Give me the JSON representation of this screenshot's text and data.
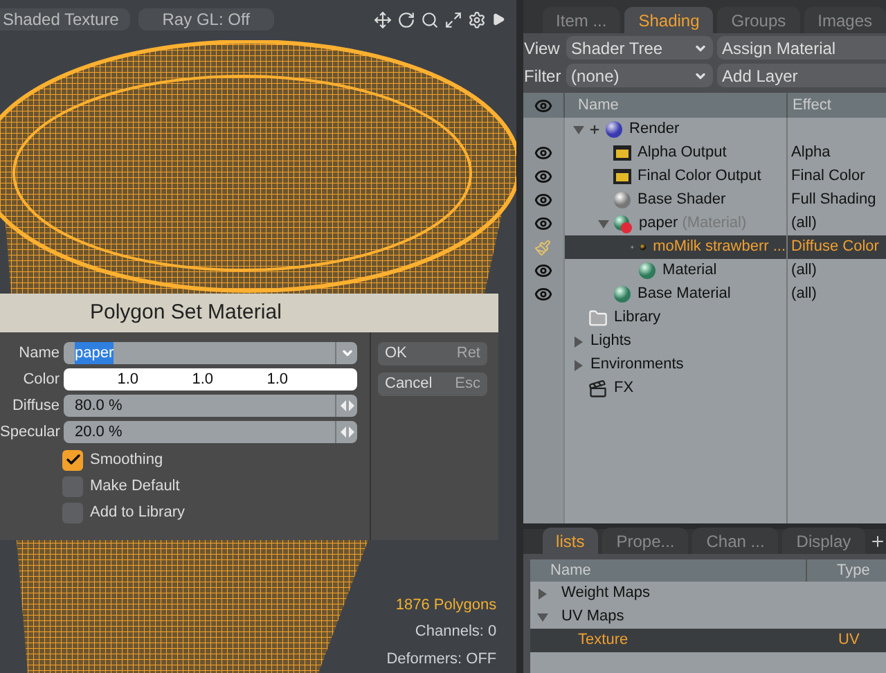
{
  "viewport": {
    "shading_mode": "Shaded Texture",
    "ray_gl": "Ray GL: Off",
    "stats": [
      {
        "text": "1876 Polygons",
        "highlight": true
      },
      {
        "text": "Channels: 0",
        "highlight": false
      },
      {
        "text": "Deformers: OFF",
        "highlight": false
      }
    ]
  },
  "dialog": {
    "title": "Polygon Set Material",
    "fields": [
      {
        "kind": "dropdown",
        "label": "Name",
        "value": "paper",
        "text_selected": true
      },
      {
        "kind": "color",
        "label": "Color",
        "values": [
          "1.0",
          "1.0",
          "1.0"
        ]
      },
      {
        "kind": "spinner",
        "label": "Diffuse",
        "value": "80.0 %"
      },
      {
        "kind": "spinner",
        "label": "Specular",
        "value": "20.0 %"
      }
    ],
    "checkboxes": [
      {
        "label": "Smoothing",
        "checked": true
      },
      {
        "label": "Make Default",
        "checked": false
      },
      {
        "label": "Add to Library",
        "checked": false
      }
    ],
    "buttons": [
      {
        "label": "OK",
        "shortcut": "Ret"
      },
      {
        "label": "Cancel",
        "shortcut": "Esc"
      }
    ]
  },
  "shader_panel": {
    "tabs": [
      {
        "label": "Item ...",
        "selected": false
      },
      {
        "label": "Shading",
        "selected": true
      },
      {
        "label": "Groups",
        "selected": false
      },
      {
        "label": "Images",
        "selected": false
      }
    ],
    "view": {
      "label": "View",
      "value": "Shader Tree",
      "action": "Assign Material"
    },
    "filter": {
      "label": "Filter",
      "value": "(none)",
      "action": "Add Layer"
    },
    "columns": [
      "Name",
      "Effect"
    ],
    "tree": [
      {
        "kind": "render",
        "name": "Render",
        "expanded": true,
        "plus": true,
        "visible": false,
        "selected": false,
        "children": [
          {
            "kind": "output",
            "name": "Alpha Output",
            "effect": "Alpha",
            "visible": true,
            "selected": false
          },
          {
            "kind": "output",
            "name": "Final Color Output",
            "effect": "Final Color",
            "visible": true,
            "selected": false
          },
          {
            "kind": "shader",
            "name": "Base Shader",
            "effect": "Full Shading",
            "visible": true,
            "selected": false
          },
          {
            "kind": "mask",
            "name": "paper",
            "type_hint": "(Material)",
            "effect": "(all)",
            "expanded": true,
            "visible": true,
            "selected": false,
            "children": [
              {
                "kind": "texture",
                "name": "moMilk strawberr ...",
                "effect": "Diffuse Color",
                "plus": true,
                "selected": true
              },
              {
                "kind": "material",
                "name": "Material",
                "effect": "(all)",
                "visible": true,
                "selected": false
              }
            ]
          },
          {
            "kind": "material",
            "name": "Base Material",
            "effect": "(all)",
            "visible": true,
            "selected": false
          }
        ]
      },
      {
        "kind": "folder",
        "name": "Library",
        "visible": false,
        "selected": false
      },
      {
        "kind": "none",
        "name": "Lights",
        "expanded": false,
        "visible": false,
        "selected": false
      },
      {
        "kind": "none",
        "name": "Environments",
        "expanded": false,
        "visible": false,
        "selected": false
      },
      {
        "kind": "fx",
        "name": "FX",
        "visible": false,
        "selected": false
      }
    ]
  },
  "lists_panel": {
    "tabs": [
      {
        "label": "lists",
        "selected": true
      },
      {
        "label": "Prope...",
        "selected": false
      },
      {
        "label": "Chan ...",
        "selected": false
      },
      {
        "label": "Display",
        "selected": false
      }
    ],
    "columns": [
      "Name",
      "Type"
    ],
    "rows": [
      {
        "name": "Weight Maps",
        "expanded": false,
        "selected": false
      },
      {
        "name": "UV Maps",
        "expanded": true,
        "selected": false,
        "children": [
          {
            "name": "Texture",
            "type": "UV",
            "selected": true
          }
        ]
      }
    ]
  }
}
